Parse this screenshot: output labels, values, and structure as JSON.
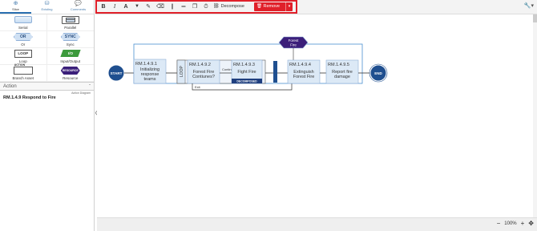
{
  "left_panel": {
    "tabs": [
      {
        "label": "Slice",
        "icon": "plus-circle-icon"
      },
      {
        "label": "Existing",
        "icon": "database-icon"
      },
      {
        "label": "Comments",
        "icon": "comments-icon"
      }
    ],
    "shapes": [
      {
        "label": "Serial",
        "tag": ""
      },
      {
        "label": "Parallel",
        "tag": ""
      },
      {
        "label": "Or",
        "tag": "OR"
      },
      {
        "label": "Sync",
        "tag": "SYNC"
      },
      {
        "label": "Loop",
        "tag": "LOOP"
      },
      {
        "label": "Input/Output",
        "tag": "I/O"
      },
      {
        "label": "Branch Asset",
        "tag": "ACTION"
      },
      {
        "label": "Resource",
        "tag": "RESOURCE"
      }
    ],
    "section": {
      "title": "Action",
      "collapse": "-"
    },
    "action_diagram_caption": "Action Diagram",
    "selected_action": "RM.1.4.9 Respond to Fire"
  },
  "toolbar": {
    "bold": "B",
    "italic": "I",
    "font_color": "A",
    "decompose_label": "Decompose",
    "remove_label": "Remove"
  },
  "diagram": {
    "start": "START",
    "end": "END",
    "nodes": [
      {
        "id": "RM.1.4.9.1",
        "text": [
          "Initializing",
          "response",
          "teams"
        ]
      },
      {
        "id": "RM.1.4.9.2",
        "text": [
          "Forest Fire",
          "Contiunes?"
        ]
      },
      {
        "id": "RM.1.4.9.3",
        "text": [
          "Fight Fire"
        ],
        "badge": "DECOMPOSED"
      },
      {
        "id": "RM.1.4.9.4",
        "text": [
          "Extinguish",
          "Forest Fire"
        ]
      },
      {
        "id": "RM.1.4.9.5",
        "text": [
          "Report fire",
          "damage"
        ]
      }
    ],
    "loop_label": "LOOP",
    "continue_label": "Continue",
    "exit_label": "Exit",
    "resource": [
      "Forest",
      "Fire"
    ]
  },
  "zoom": {
    "minus": "−",
    "level": "100%",
    "plus": "+",
    "fit": "✥"
  }
}
